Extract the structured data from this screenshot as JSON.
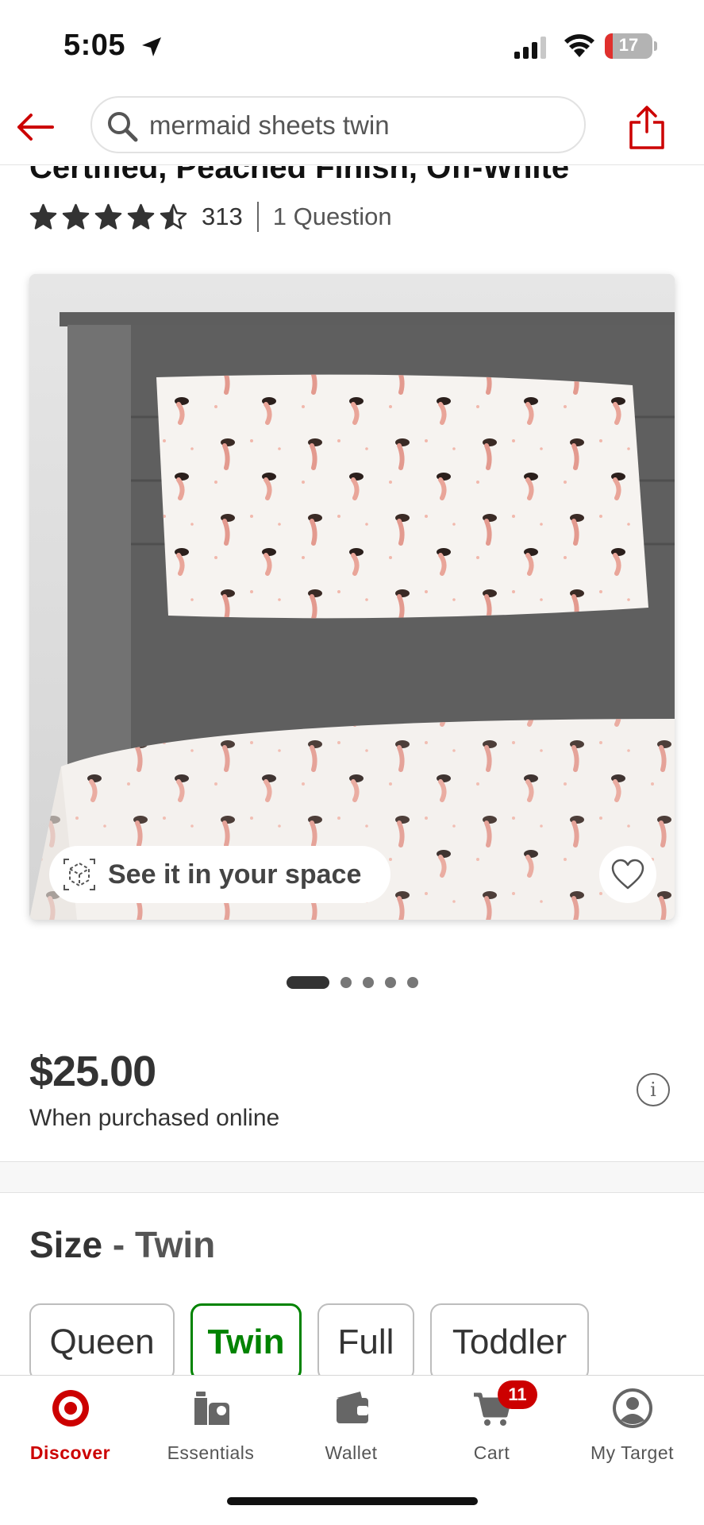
{
  "status_bar": {
    "time": "5:05",
    "battery_percent": "17",
    "battery_level": 0.17,
    "icons": [
      "location-arrow-icon",
      "signal-icon",
      "wifi-icon",
      "battery-icon"
    ]
  },
  "header": {
    "search_query": "mermaid sheets twin",
    "icons": [
      "back-arrow-icon",
      "search-icon",
      "share-icon"
    ]
  },
  "product": {
    "title_fragment": "Certified, Peached Finish, Off-White",
    "rating": 4.5,
    "review_count": "313",
    "questions": "1 Question",
    "see_in_space": "See it in your space",
    "image_count": 5,
    "image_index": 1,
    "price": "$25.00",
    "price_note": "When purchased online"
  },
  "size": {
    "label": "Size",
    "separator": " - ",
    "selected": "Twin",
    "options": [
      "Queen",
      "Twin",
      "Full",
      "Toddler"
    ]
  },
  "tabbar": {
    "tabs": [
      {
        "label": "Discover",
        "icon": "target-bullseye-icon",
        "active": true
      },
      {
        "label": "Essentials",
        "icon": "essentials-icon",
        "active": false
      },
      {
        "label": "Wallet",
        "icon": "wallet-icon",
        "active": false
      },
      {
        "label": "Cart",
        "icon": "cart-icon",
        "active": false
      },
      {
        "label": "My Target",
        "icon": "account-icon",
        "active": false
      }
    ],
    "cart_badge": "11"
  },
  "colors": {
    "brand_red": "#cc0000",
    "selected_green": "#008300",
    "text_dark": "#333333"
  }
}
